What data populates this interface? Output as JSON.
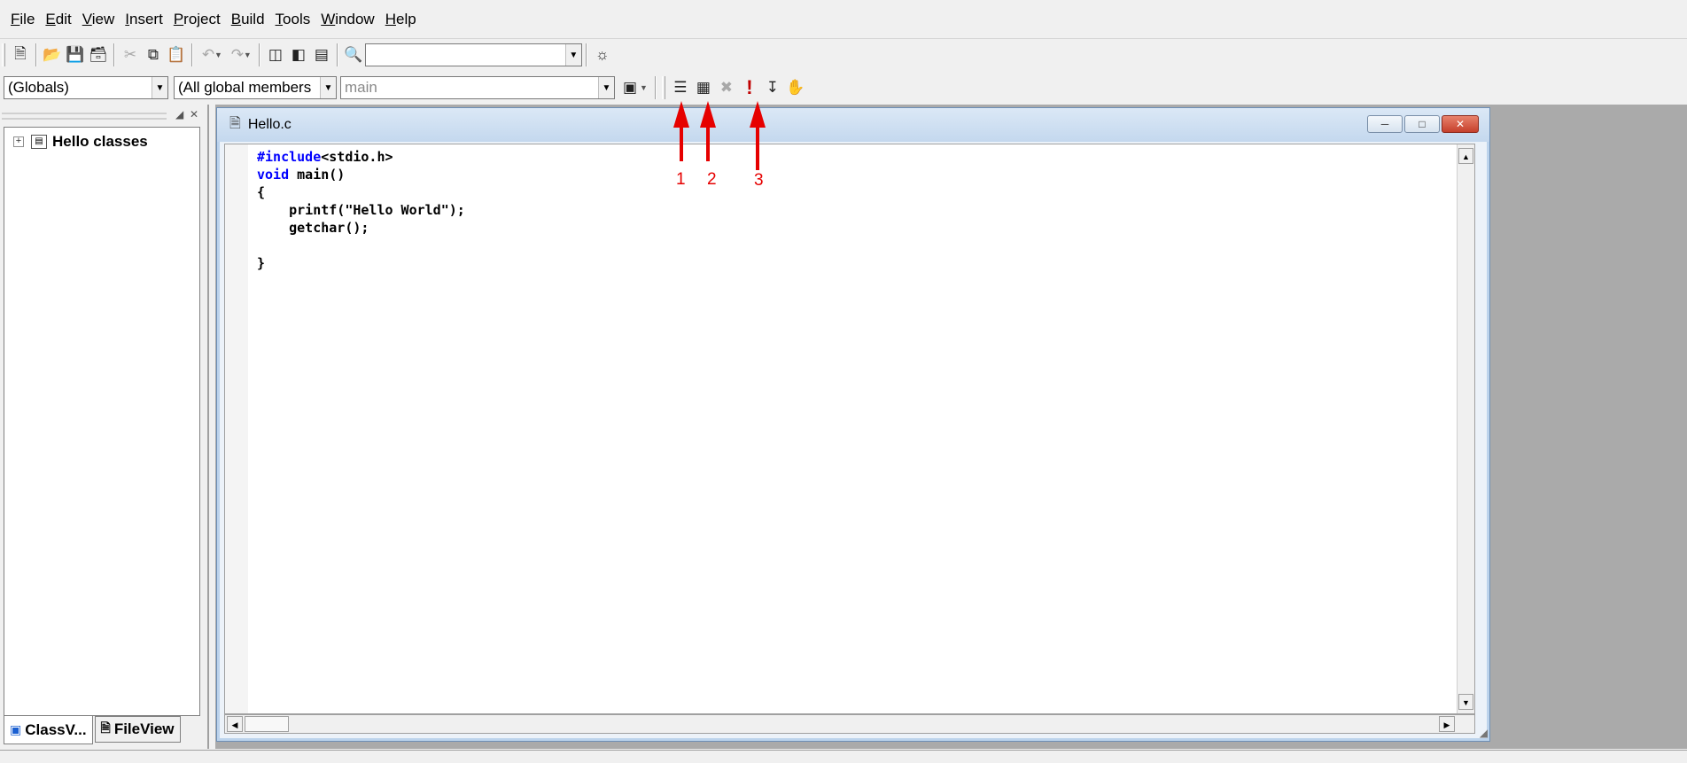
{
  "menu": {
    "items": [
      {
        "label": "File",
        "key": "F",
        "rest": "ile"
      },
      {
        "label": "Edit",
        "key": "E",
        "rest": "dit"
      },
      {
        "label": "View",
        "key": "V",
        "rest": "iew"
      },
      {
        "label": "Insert",
        "key": "I",
        "rest": "nsert"
      },
      {
        "label": "Project",
        "key": "P",
        "rest": "roject"
      },
      {
        "label": "Build",
        "key": "B",
        "rest": "uild"
      },
      {
        "label": "Tools",
        "key": "T",
        "rest": "ools"
      },
      {
        "label": "Window",
        "key": "W",
        "rest": "indow"
      },
      {
        "label": "Help",
        "key": "H",
        "rest": "elp"
      }
    ]
  },
  "toolbar": {
    "find_value": ""
  },
  "wizardbar": {
    "class_combo": "(Globals)",
    "filter_combo": "(All global members",
    "member_combo": "main"
  },
  "workspace": {
    "tree_root": "Hello classes",
    "tab_classview": "ClassV...",
    "tab_fileview": "FileView"
  },
  "editor": {
    "title": "Hello.c",
    "code_lines": [
      {
        "kw": "#include",
        "text": "<stdio.h>"
      },
      {
        "kw": "void",
        "text": " main()"
      },
      {
        "kw": "",
        "text": "{"
      },
      {
        "kw": "",
        "text": "    printf(\"Hello World\");"
      },
      {
        "kw": "",
        "text": "    getchar();"
      },
      {
        "kw": "",
        "text": ""
      },
      {
        "kw": "",
        "text": "}"
      }
    ]
  },
  "annotations": {
    "labels": [
      "1",
      "2",
      "3"
    ],
    "color": "#e60000"
  },
  "colors": {
    "keyword": "#0000ff",
    "mdi_background": "#aaaaaa"
  }
}
